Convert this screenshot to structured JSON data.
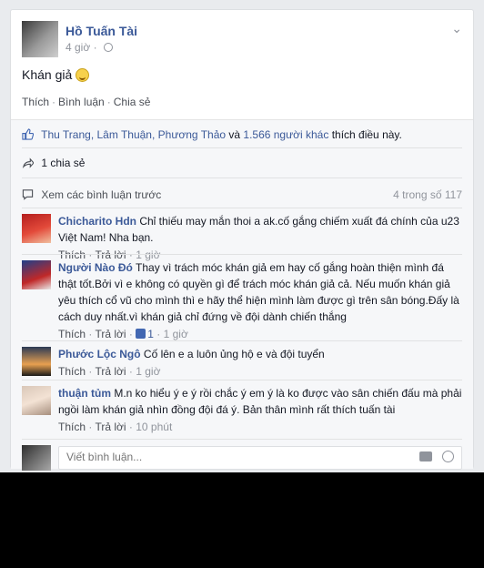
{
  "post": {
    "author": "Hồ Tuấn Tài",
    "time": "4 giờ",
    "text": "Khán giả",
    "actions": [
      "Thích",
      "Bình luận",
      "Chia sẻ"
    ]
  },
  "likes": {
    "names": "Thu Trang, Lâm Thuận, Phương Thảo",
    "and": " và ",
    "others": "1.566 người khác",
    "suffix": " thích điều này."
  },
  "shares": {
    "text": "1 chia sẻ"
  },
  "comments_header": {
    "previous": "Xem các bình luận trước",
    "count": "4 trong số 117"
  },
  "comments": [
    {
      "name": "Chicharito Hdn",
      "text": "Chỉ thiếu may mắn thoi a ak.cố gắng chiếm xuất đá chính của u23 Việt Nam! Nha bạn.",
      "like": "Thích",
      "reply": "Trả lời",
      "time": "1 giờ"
    },
    {
      "name": "Người Nào Đó",
      "text": "Thay vì trách móc khán giả em hay cố gắng hoàn thiện mình đá thật tốt.Bởi vì e không có quyền gì để trách móc khán giả cả. Nếu muốn khán giả yêu thích cổ vũ cho mình thì e hãy thể hiện mình làm được gì trên sân bóng.Đấy là cách duy nhất.vì khán giả chỉ đứng về đội dành chiến thắng",
      "like": "Thích",
      "reply": "Trả lời",
      "likes": "1",
      "time": "1 giờ"
    },
    {
      "name": "Phước Lộc Ngô",
      "text": "Cố lên e a luôn ủng hộ e và đội tuyển",
      "like": "Thích",
      "reply": "Trả lời",
      "time": "1 giờ"
    },
    {
      "name": "thuận tủm",
      "text": "M.n ko hiểu ý e ý rồi chắc ý em ý là ko được vào sân chiến đấu mà phải ngồi làm khán giả nhìn đồng đội đá ý. Bản thân mình rất thích tuấn tài",
      "like": "Thích",
      "reply": "Trả lời",
      "time": "10 phút"
    }
  ],
  "composer": {
    "placeholder": "Viết bình luận..."
  },
  "icons": [
    "globe-icon",
    "chevron-down-icon",
    "smile-emoji-icon",
    "thumbs-up-icon",
    "share-arrow-icon",
    "comment-icon",
    "camera-icon",
    "emoji-icon"
  ],
  "colors": {
    "link": "#3b5998",
    "muted": "#90949c",
    "background": "#e9ebee"
  }
}
